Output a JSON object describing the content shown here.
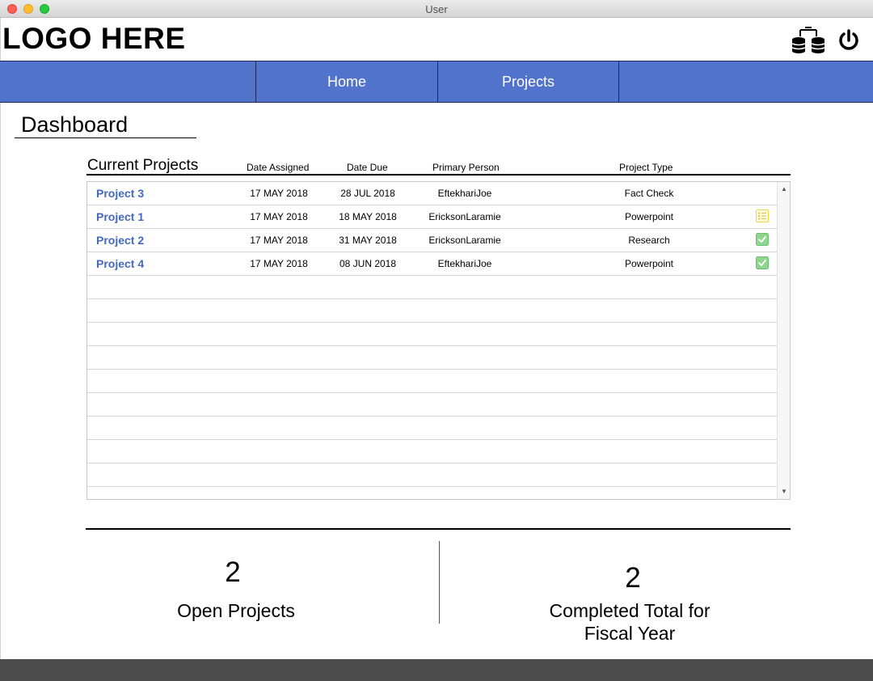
{
  "window": {
    "title": "User"
  },
  "header": {
    "logo": "LOGO HERE",
    "icons": [
      "database-sync-icon",
      "power-icon"
    ]
  },
  "nav": {
    "items": [
      {
        "label": "Home"
      },
      {
        "label": "Projects"
      }
    ]
  },
  "dashboard": {
    "title": "Dashboard"
  },
  "projects": {
    "section_title": "Current Projects",
    "columns": [
      "Date Assigned",
      "Date Due",
      "Primary Person",
      "Project Type"
    ],
    "rows": [
      {
        "name": "Project 3",
        "assigned": "17 MAY 2018",
        "due": "28 JUL 2018",
        "person": "EftekhariJoe",
        "type": "Fact Check",
        "status": "none"
      },
      {
        "name": "Project 1",
        "assigned": "17 MAY 2018",
        "due": "18 MAY 2018",
        "person": "EricksonLaramie",
        "type": "Powerpoint",
        "status": "list-icon"
      },
      {
        "name": "Project 2",
        "assigned": "17 MAY 2018",
        "due": "31 MAY 2018",
        "person": "EricksonLaramie",
        "type": "Research",
        "status": "check-icon"
      },
      {
        "name": "Project 4",
        "assigned": "17 MAY 2018",
        "due": "08 JUN 2018",
        "person": "EftekhariJoe",
        "type": "Powerpoint",
        "status": "check-icon"
      }
    ]
  },
  "summary": {
    "open": {
      "count": "2",
      "label": "Open Projects"
    },
    "completed": {
      "count": "2",
      "label_line1": "Completed Total for",
      "label_line2": "Fiscal Year"
    }
  },
  "colors": {
    "nav": "#5273cc",
    "link": "#4469c0",
    "footer": "#4b4b4b",
    "check": "#7fcf7f",
    "list": "#f0d84a"
  }
}
